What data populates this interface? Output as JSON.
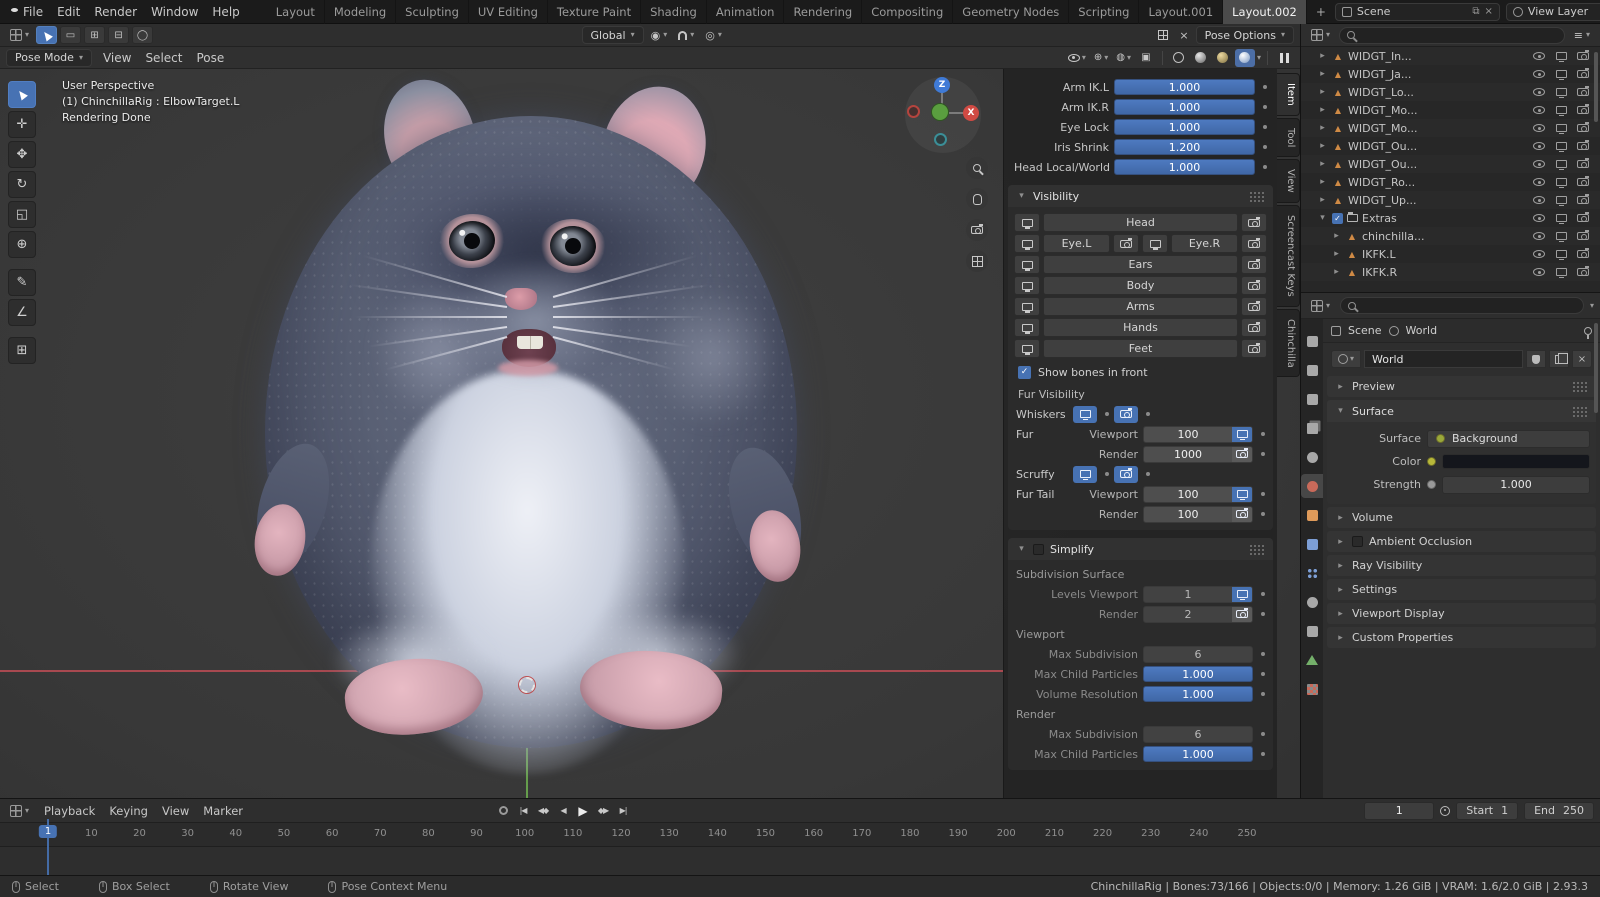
{
  "topbar": {
    "menus": [
      "File",
      "Edit",
      "Render",
      "Window",
      "Help"
    ],
    "workspaces": [
      "Layout",
      "Modeling",
      "Sculpting",
      "UV Editing",
      "Texture Paint",
      "Shading",
      "Animation",
      "Rendering",
      "Compositing",
      "Geometry Nodes",
      "Scripting",
      "Layout.001",
      "Layout.002"
    ],
    "active_workspace": "Layout.002",
    "add_workspace_label": "+",
    "scene_label": "Scene",
    "view_layer_label": "View Layer"
  },
  "tool_header": {
    "orientation_label": "Global",
    "pose_options_label": "Pose Options"
  },
  "viewport_header": {
    "mode_label": "Pose Mode",
    "menus": [
      "View",
      "Select",
      "Pose"
    ]
  },
  "viewport": {
    "overlay_lines": [
      "User Perspective",
      "(1) ChinchillaRig : ElbowTarget.L",
      "Rendering Done"
    ],
    "gizmo_axis_labels": {
      "z": "Z",
      "x": "X"
    },
    "tools": [
      "select-box",
      "cursor",
      "move",
      "rotate",
      "scale",
      "transform",
      "annotate",
      "measure",
      "add-primitive"
    ]
  },
  "n_panel": {
    "tabs": [
      "Item",
      "Tool",
      "View",
      "Screencast Keys",
      "Chinchilla"
    ],
    "active_tab": "Item",
    "sliders": [
      {
        "label": "Arm IK.L",
        "value": "1.000"
      },
      {
        "label": "Arm IK.R",
        "value": "1.000"
      },
      {
        "label": "Eye Lock",
        "value": "1.000"
      },
      {
        "label": "Iris Shrink",
        "value": "1.200"
      },
      {
        "label": "Head Local/World",
        "value": "1.000"
      }
    ],
    "visibility": {
      "title": "Visibility",
      "rows": [
        [
          "Head"
        ],
        [
          "Eye.L",
          "Eye.R"
        ],
        [
          "Ears"
        ],
        [
          "Body"
        ],
        [
          "Arms"
        ],
        [
          "Hands"
        ],
        [
          "Feet"
        ]
      ],
      "show_bones_label": "Show bones in front",
      "fur_visibility_label": "Fur Visibility",
      "viewport_label": "Viewport",
      "render_label": "Render",
      "fur_items": [
        {
          "type": "toggles",
          "label": "Whiskers"
        },
        {
          "type": "fields",
          "label": "Fur",
          "viewport": "100",
          "render": "1000"
        },
        {
          "type": "toggles",
          "label": "Scruffy"
        },
        {
          "type": "fields",
          "label": "Fur Tail",
          "viewport": "100",
          "render": "100"
        }
      ]
    },
    "simplify": {
      "title": "Simplify",
      "rows": [
        {
          "type": "section",
          "label": "Subdivision Surface"
        },
        {
          "type": "field",
          "label": "Levels Viewport",
          "value": "1",
          "icon": "monitor"
        },
        {
          "type": "field",
          "label": "Render",
          "value": "2",
          "icon": "camera"
        },
        {
          "type": "section",
          "label": "Viewport"
        },
        {
          "type": "field",
          "label": "Max Subdivision",
          "value": "6"
        },
        {
          "type": "slider",
          "label": "Max Child Particles",
          "value": "1.000"
        },
        {
          "type": "slider",
          "label": "Volume Resolution",
          "value": "1.000"
        },
        {
          "type": "section",
          "label": "Render"
        },
        {
          "type": "field",
          "label": "Max Subdivision",
          "value": "6"
        },
        {
          "type": "slider",
          "label": "Max Child Particles",
          "value": "1.000"
        }
      ]
    }
  },
  "outliner": {
    "rows": [
      {
        "name": "WIDGT_In...",
        "kind": "object"
      },
      {
        "name": "WIDGT_Ja...",
        "kind": "object"
      },
      {
        "name": "WIDGT_Lo...",
        "kind": "object"
      },
      {
        "name": "WIDGT_Mo...",
        "kind": "object"
      },
      {
        "name": "WIDGT_Mo...",
        "kind": "object"
      },
      {
        "name": "WIDGT_Ou...",
        "kind": "object"
      },
      {
        "name": "WIDGT_Ou...",
        "kind": "object"
      },
      {
        "name": "WIDGT_Ro...",
        "kind": "object"
      },
      {
        "name": "WIDGT_Up...",
        "kind": "object"
      },
      {
        "name": "Extras",
        "kind": "collection",
        "checked": true
      },
      {
        "name": "chinchilla...",
        "kind": "object",
        "child": true
      },
      {
        "name": "IKFK.L",
        "kind": "object",
        "child": true
      },
      {
        "name": "IKFK.R",
        "kind": "object",
        "child": true
      }
    ]
  },
  "properties": {
    "breadcrumb": {
      "scene": "Scene",
      "world": "World"
    },
    "world_name": "World",
    "panels_top": [
      "Preview"
    ],
    "surface_panel": {
      "title": "Surface",
      "surface_label": "Surface",
      "surface_value": "Background",
      "color_label": "Color",
      "strength_label": "Strength",
      "strength_value": "1.000"
    },
    "panels_bottom": [
      {
        "label": "Volume"
      },
      {
        "label": "Ambient Occlusion",
        "checkbox": true
      },
      {
        "label": "Ray Visibility"
      },
      {
        "label": "Settings"
      },
      {
        "label": "Viewport Display"
      },
      {
        "label": "Custom Properties"
      }
    ],
    "tabs": [
      "tool",
      "render",
      "output",
      "view-layer",
      "scene",
      "world",
      "object",
      "modifiers",
      "particles",
      "physics",
      "constraints",
      "object-data",
      "texture"
    ],
    "active_tab": "world"
  },
  "timeline": {
    "menus": [
      "Playback",
      "Keying",
      "View",
      "Marker"
    ],
    "current_frame": "1",
    "start_label": "Start",
    "start_value": "1",
    "end_label": "End",
    "end_value": "250",
    "ticks": [
      10,
      20,
      30,
      40,
      50,
      60,
      70,
      80,
      90,
      100,
      110,
      120,
      130,
      140,
      150,
      160,
      170,
      180,
      190,
      200,
      210,
      220,
      230,
      240,
      250
    ]
  },
  "statusbar": {
    "hints": [
      "Select",
      "Box Select",
      "Rotate View",
      "Pose Context Menu"
    ],
    "stats": "ChinchillaRig | Bones:73/166 | Objects:0/0 | Memory: 1.26 GiB | VRAM: 1.6/2.0 GiB | 2.93.3"
  }
}
